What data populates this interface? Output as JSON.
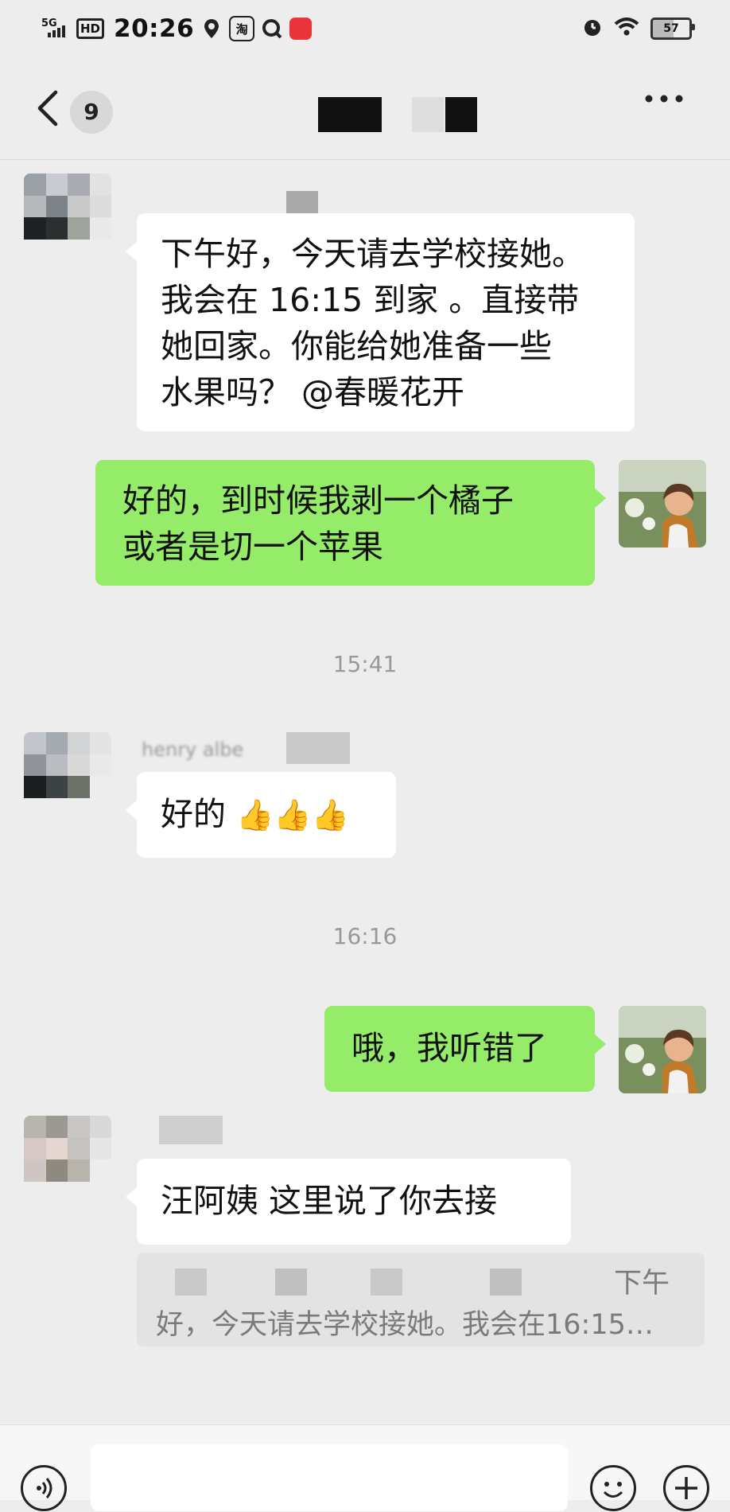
{
  "status_bar": {
    "network": "5G",
    "hd": "HD",
    "time": "20:26",
    "taobao": "淘",
    "battery": "57"
  },
  "header": {
    "unread_count": "9",
    "more_label": "···"
  },
  "messages": [
    {
      "side": "left",
      "text_lines": [
        "下午好，今天请去学校接她。",
        "我会在 16:15 到家 。直接带",
        "她回家。你能给她准备一些",
        "水果吗？ @春暖花开"
      ]
    },
    {
      "side": "right",
      "text_lines": [
        "好的，到时候我剥一个橘子",
        "或者是切一个苹果"
      ]
    },
    {
      "timestamp": "15:41"
    },
    {
      "side": "left",
      "sender": "henry albe",
      "text": "好的",
      "emoji": "👍👍👍"
    },
    {
      "timestamp": "16:16"
    },
    {
      "side": "right",
      "text": "哦，我听错了"
    },
    {
      "side": "left",
      "text": "汪阿姨 这里说了你去接"
    }
  ],
  "quote": {
    "line1_tail": "下午",
    "line2": "好，今天请去学校接她。我会在16:15…"
  },
  "colors": {
    "background": "#ededed",
    "bubble_green": "#95ec69",
    "bubble_white": "#ffffff"
  },
  "icons": [
    "back-arrow-icon",
    "more-dots-icon",
    "voice-icon",
    "emoji-icon",
    "plus-icon"
  ]
}
